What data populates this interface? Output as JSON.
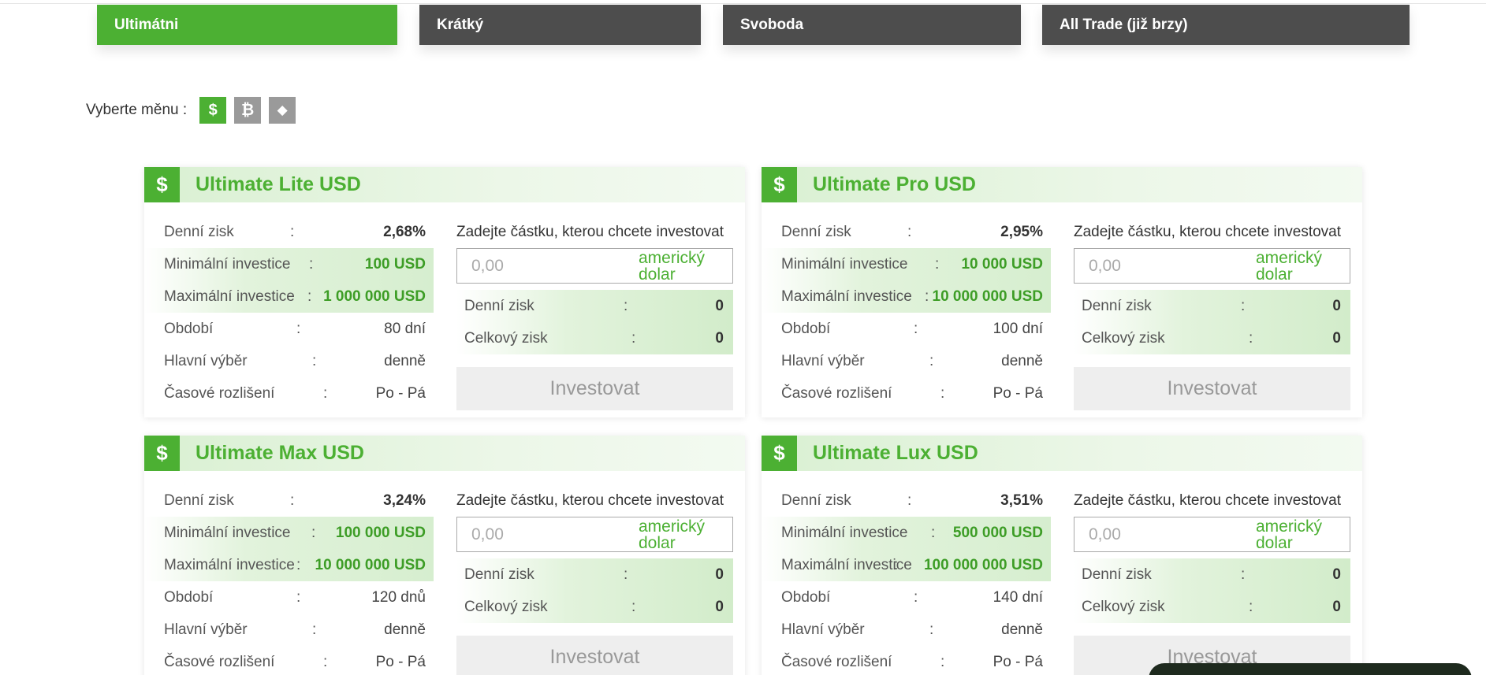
{
  "tabs": [
    {
      "label": "Ultimátni",
      "active": true
    },
    {
      "label": "Krátký",
      "active": false
    },
    {
      "label": "Svoboda",
      "active": false
    },
    {
      "label": "All Trade (již brzy)",
      "active": false
    }
  ],
  "currency": {
    "label": "Vyberte měnu :",
    "options": [
      {
        "name": "dollar-icon",
        "glyph": "$",
        "active": true
      },
      {
        "name": "bitcoin-icon",
        "glyph": "₿",
        "active": false
      },
      {
        "name": "ethereum-icon",
        "glyph": "◆",
        "active": false
      }
    ]
  },
  "common": {
    "colon": ":",
    "calc_label": "Zadejte částku, kterou chcete investovat",
    "placeholder": "0,00",
    "unit": "americký dolar",
    "invest": "Investovat",
    "labels": {
      "daily": "Denní zisk",
      "min": "Minimální investice",
      "max": "Maximální investice",
      "period": "Období",
      "withdraw": "Hlavní výběr",
      "schedule": "Časové rozlišení",
      "total": "Celkový zisk"
    }
  },
  "plans": [
    {
      "title": "Ultimate Lite USD",
      "daily": "2,68%",
      "min": "100 USD",
      "max": "1 000 000 USD",
      "period": "80 dní",
      "withdraw": "denně",
      "schedule": "Po - Pá",
      "res_daily": "0",
      "res_total": "0"
    },
    {
      "title": "Ultimate Pro USD",
      "daily": "2,95%",
      "min": "10 000 USD",
      "max": "10 000 000 USD",
      "period": "100 dní",
      "withdraw": "denně",
      "schedule": "Po - Pá",
      "res_daily": "0",
      "res_total": "0"
    },
    {
      "title": "Ultimate Max USD",
      "daily": "3,24%",
      "min": "100 000 USD",
      "max": "10 000 000 USD",
      "period": "120 dnů",
      "withdraw": "denně",
      "schedule": "Po - Pá",
      "res_daily": "0",
      "res_total": "0"
    },
    {
      "title": "Ultimate Lux USD",
      "daily": "3,51%",
      "min": "500 000 USD",
      "max": "100 000 000 USD",
      "period": "140 dní",
      "withdraw": "denně",
      "schedule": "Po - Pá",
      "res_daily": "0",
      "res_total": "0"
    }
  ],
  "colors": {
    "accent": "#4cb033",
    "tab_dark": "#4d4d4d",
    "button_disabled": "#eeeeee"
  }
}
